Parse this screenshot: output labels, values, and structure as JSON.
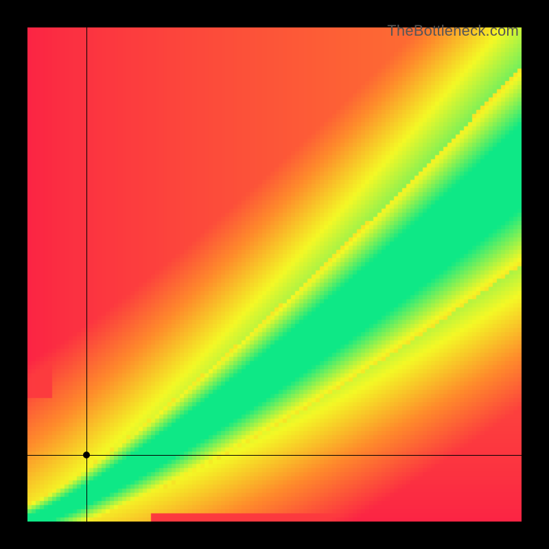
{
  "watermark": "TheBottleneck.com",
  "chart_data": {
    "type": "heatmap",
    "title": "",
    "xlabel": "",
    "ylabel": "",
    "xlim": [
      0,
      1
    ],
    "ylim": [
      0,
      1
    ],
    "grid": false,
    "legend": false,
    "axes_visible": false,
    "description": "Continuous 2D color field: green diagonal band (optimal match), yellow widening toward upper-right (mild mismatch), red in upper-left/lower-right corners (heavy bottleneck).",
    "crosshair": {
      "x": 0.119,
      "y": 0.135
    },
    "marker": {
      "x": 0.119,
      "y": 0.135
    },
    "diagonal": {
      "end_y_at_x1": 0.72,
      "curvature": 1.22,
      "green_halfwidth_start": 0.012,
      "green_halfwidth_end": 0.085,
      "yellow_halfwidth_start": 0.035,
      "yellow_halfwidth_end": 0.2
    },
    "colors": {
      "red": "#fb2344",
      "orange": "#fe8b2b",
      "yellow": "#f4f825",
      "green": "#0ee886"
    }
  }
}
